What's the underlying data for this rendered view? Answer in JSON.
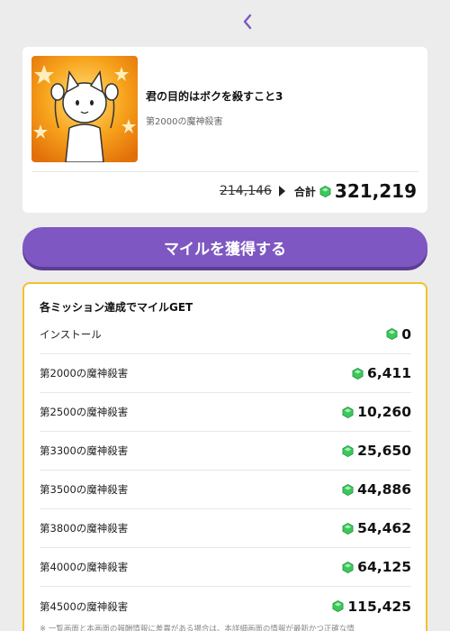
{
  "header": {
    "back_icon": "chevron-left-icon"
  },
  "app": {
    "title": "君の目的はボクを殺すこと3",
    "subtitle": "第2000の魔神殺害",
    "old_price": "214,146",
    "total_label": "合計",
    "total_value": "321,219"
  },
  "cta": {
    "label": "マイルを獲得する"
  },
  "missions": {
    "title": "各ミッション達成でマイルGET",
    "items": [
      {
        "label": "インストール",
        "value": "0"
      },
      {
        "label": "第2000の魔神殺害",
        "value": "6,411"
      },
      {
        "label": "第2500の魔神殺害",
        "value": "10,260"
      },
      {
        "label": "第3300の魔神殺害",
        "value": "25,650"
      },
      {
        "label": "第3500の魔神殺害",
        "value": "44,886"
      },
      {
        "label": "第3800の魔神殺害",
        "value": "54,462"
      },
      {
        "label": "第4000の魔神殺害",
        "value": "64,125"
      },
      {
        "label": "第4500の魔神殺害",
        "value": "115,425"
      }
    ],
    "note": "※ 一覧画面と本画面の報酬情報に差異がある場合は、本詳細画面の情報が最新かつ正確な情"
  },
  "colors": {
    "accent": "#7e57c2",
    "border": "#f3c12c",
    "gem": "#3cc85a"
  }
}
